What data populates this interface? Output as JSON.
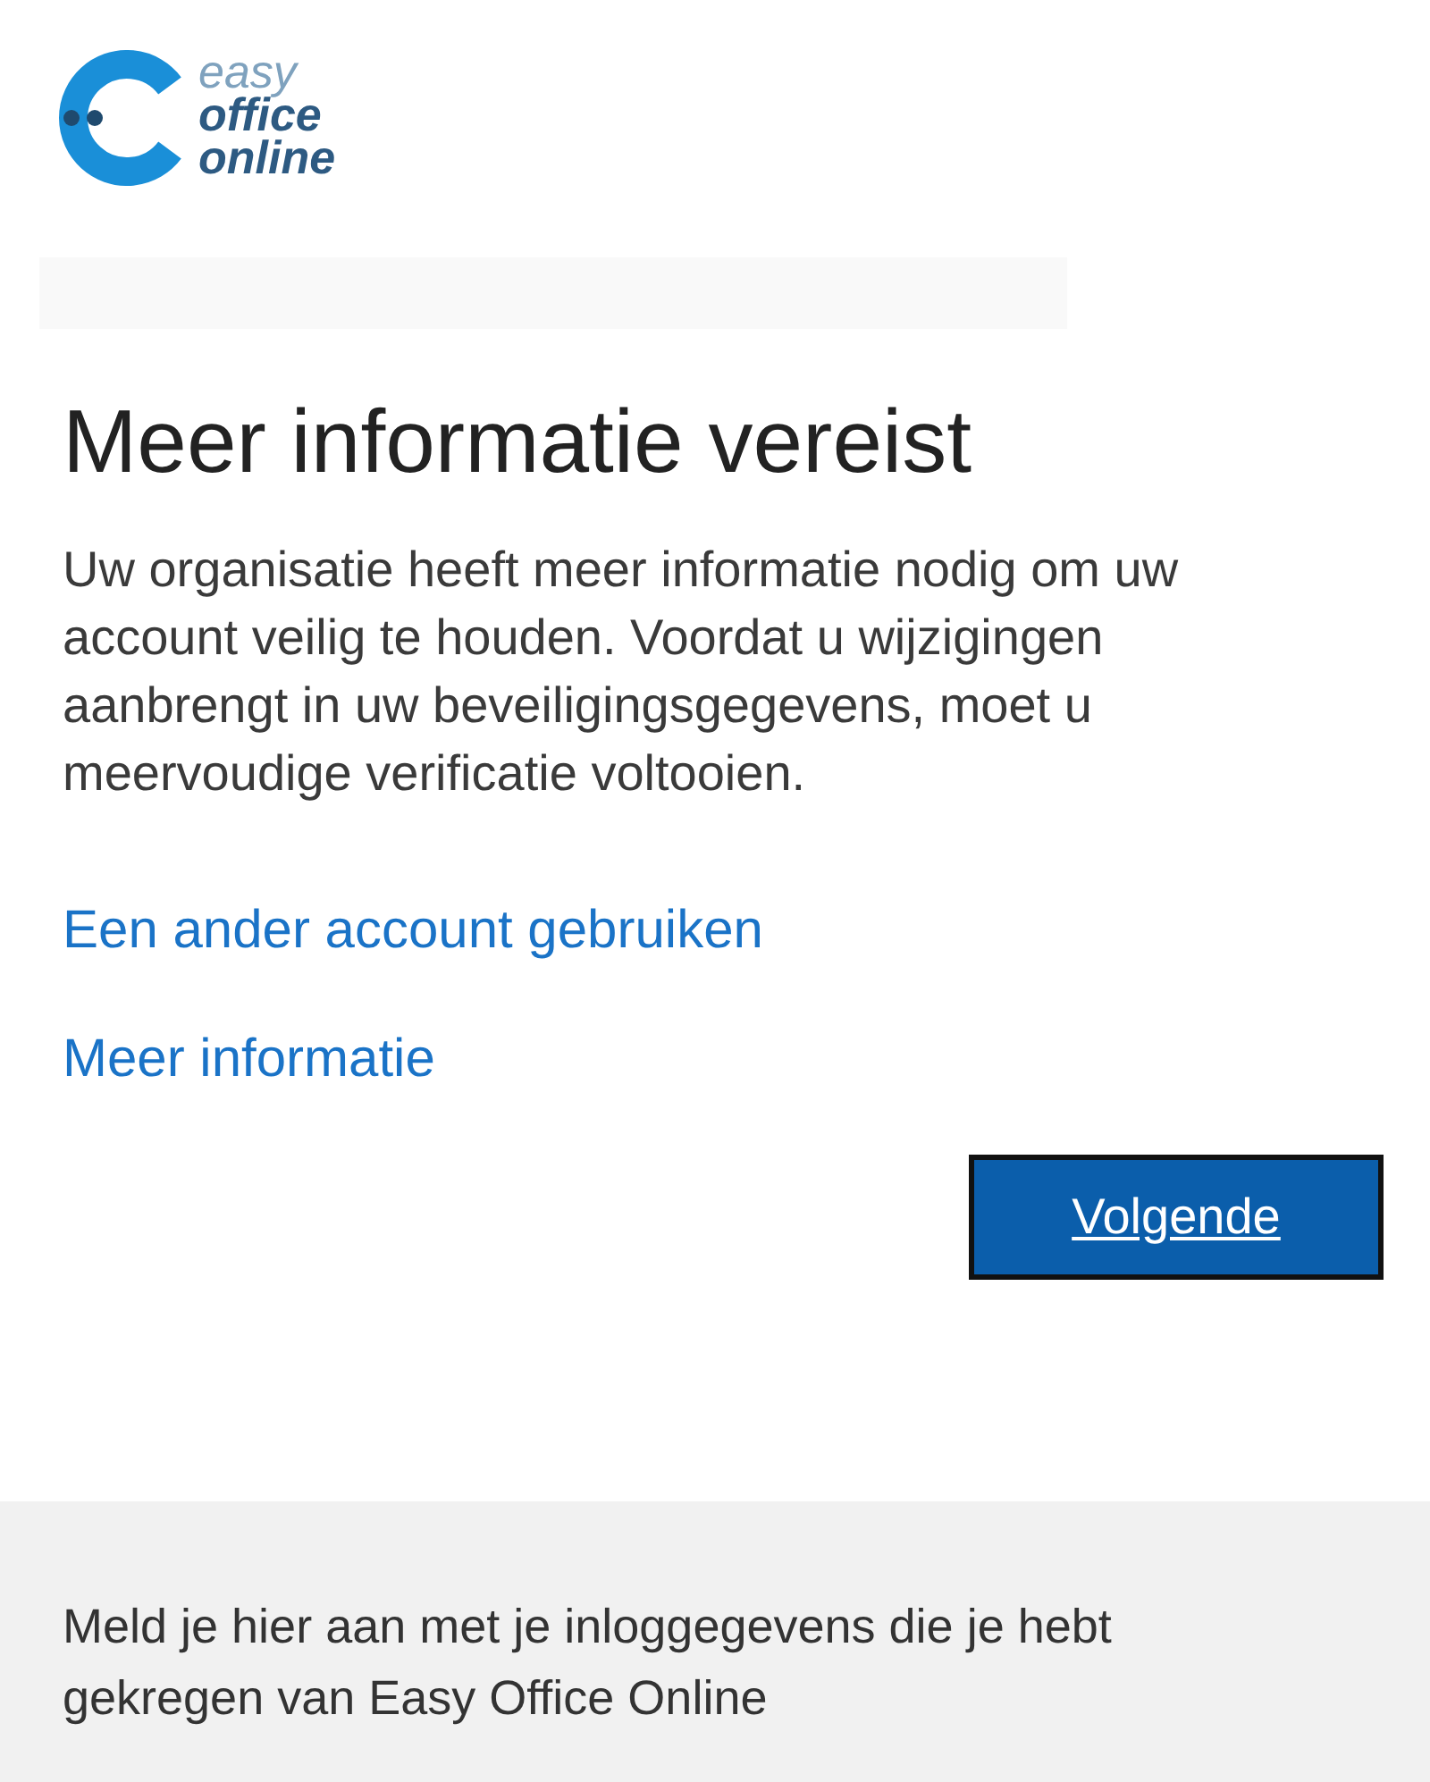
{
  "logo": {
    "line_1": "easy",
    "line_2": "office",
    "line_3": "online"
  },
  "title": "Meer informatie vereist",
  "description": "Uw organisatie heeft meer informatie nodig om uw account veilig te houden. Voordat u wijzigingen aanbrengt in uw beveiligingsgegevens, moet u meervoudige verificatie voltooien.",
  "links": [
    "Een ander account gebruiken",
    "Meer informatie"
  ],
  "button": "Volgende",
  "footer": "Meld je hier aan met je inloggegevens die je hebt gekregen van Easy Office Online"
}
